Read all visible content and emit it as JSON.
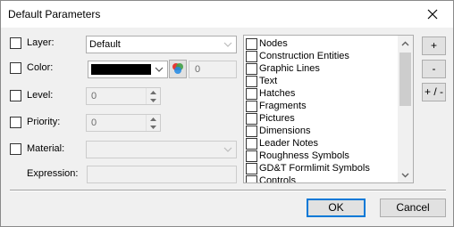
{
  "window": {
    "title": "Default Parameters"
  },
  "fields": {
    "layer": {
      "label": "Layer:",
      "value": "Default"
    },
    "color": {
      "label": "Color:",
      "swatch": "#000000",
      "number": "0"
    },
    "level": {
      "label": "Level:",
      "value": "0"
    },
    "priority": {
      "label": "Priority:",
      "value": "0"
    },
    "material": {
      "label": "Material:",
      "value": ""
    },
    "expression": {
      "label": "Expression:",
      "value": ""
    }
  },
  "list": {
    "items": [
      {
        "label": "Nodes",
        "checked": false
      },
      {
        "label": "Construction Entities",
        "checked": false
      },
      {
        "label": "Graphic Lines",
        "checked": false
      },
      {
        "label": "Text",
        "checked": false
      },
      {
        "label": "Hatches",
        "checked": false
      },
      {
        "label": "Fragments",
        "checked": false
      },
      {
        "label": "Pictures",
        "checked": false
      },
      {
        "label": "Dimensions",
        "checked": false
      },
      {
        "label": "Leader Notes",
        "checked": false
      },
      {
        "label": "Roughness Symbols",
        "checked": false
      },
      {
        "label": "GD&T Formlimit Symbols",
        "checked": false
      },
      {
        "label": "Controls",
        "checked": false
      }
    ]
  },
  "side_buttons": {
    "add": "+",
    "remove": "-",
    "toggle": "+ / -"
  },
  "footer": {
    "ok": "OK",
    "cancel": "Cancel"
  }
}
